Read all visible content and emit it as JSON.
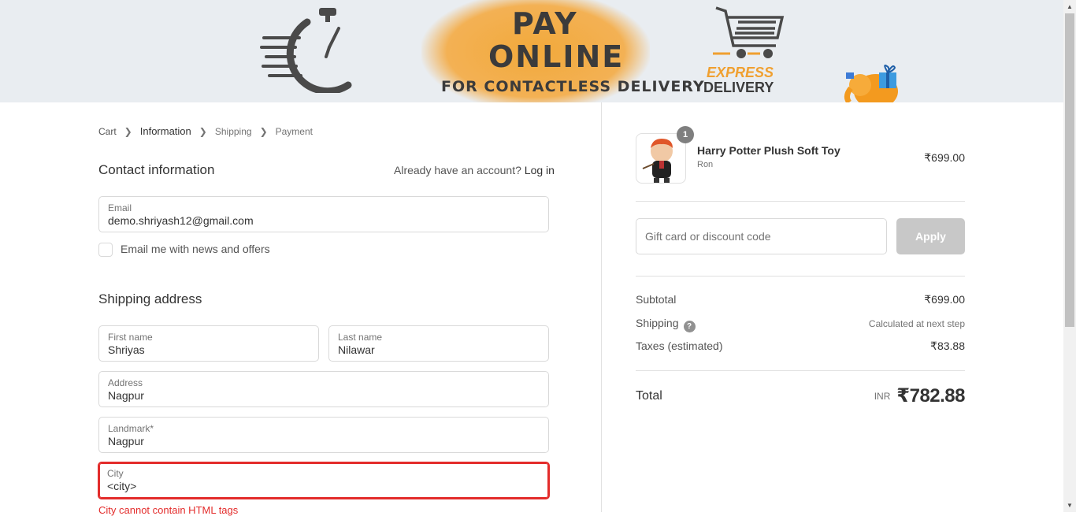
{
  "banner": {
    "line1": "PAY",
    "line2": "ONLINE",
    "line3": "FOR CONTACTLESS DELIVERY",
    "express1": "EXPRESS",
    "express2": "DELIVERY"
  },
  "breadcrumb": {
    "cart": "Cart",
    "information": "Information",
    "shipping": "Shipping",
    "payment": "Payment"
  },
  "contact": {
    "title": "Contact information",
    "account_prompt": "Already have an account?",
    "login_label": "Log in",
    "email_label": "Email",
    "email_value": "demo.shriyash12@gmail.com",
    "newsletter_label": "Email me with news and offers"
  },
  "shipping": {
    "title": "Shipping address",
    "first_name_label": "First name",
    "first_name_value": "Shriyas",
    "last_name_label": "Last name",
    "last_name_value": "Nilawar",
    "address_label": "Address",
    "address_value": "Nagpur",
    "landmark_label": "Landmark*",
    "landmark_value": "Nagpur",
    "city_label": "City",
    "city_value": "<city>",
    "city_error": "City cannot contain HTML tags"
  },
  "summary": {
    "product_name": "Harry Potter Plush Soft Toy",
    "product_variant": "Ron",
    "product_price": "₹699.00",
    "quantity": "1",
    "discount_placeholder": "Gift card or discount code",
    "apply_label": "Apply",
    "subtotal_label": "Subtotal",
    "subtotal_value": "₹699.00",
    "shipping_label": "Shipping",
    "shipping_value": "Calculated at next step",
    "taxes_label": "Taxes (estimated)",
    "taxes_value": "₹83.88",
    "total_label": "Total",
    "total_currency": "INR",
    "total_value": "₹782.88"
  },
  "colors": {
    "error": "#e32c2b",
    "banner_bg": "#e9edf1",
    "banner_accent": "#f2a93b",
    "apply_disabled": "#c8c8c8"
  },
  "icons": [
    "stopwatch-icon",
    "shopping-cart-icon",
    "elephant-gift-icon",
    "chevron-right-icon",
    "help-icon"
  ]
}
